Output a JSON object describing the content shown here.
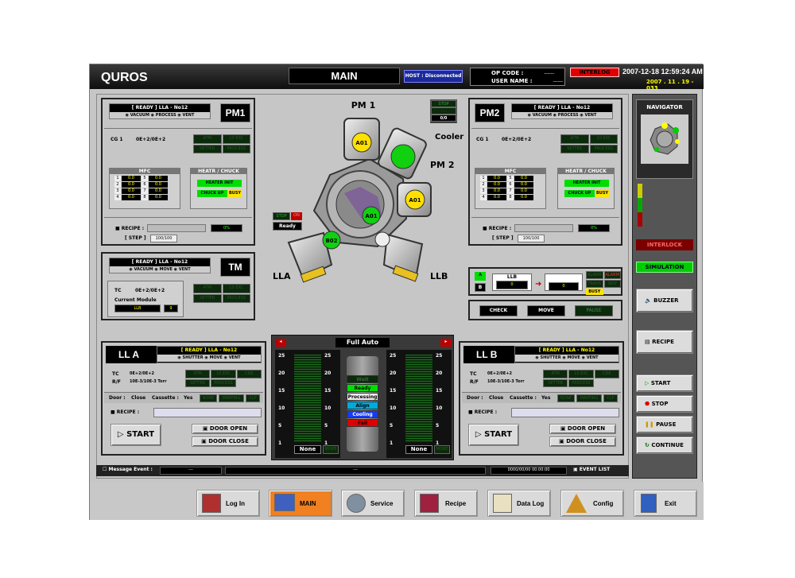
{
  "header": {
    "logo": "QUROS",
    "main": "MAIN",
    "host": "HOST : Disconnected",
    "op_code": "OP CODE :",
    "user_name": "USER NAME :",
    "op_val": "------",
    "user_val": "------",
    "interlog": "INTERLOG",
    "datetime": "2007-12-18 12:59:24 AM",
    "version": "2007 . 11 . 19 - 033"
  },
  "pm1": {
    "status": "[ READY ]  LLA - No12",
    "radios": [
      "VACUUM",
      "PROCESS",
      "VENT"
    ],
    "title": "PM1",
    "cg_label": "CG 1",
    "cg_val": "0E+2/0E+2",
    "state_cells": [
      "ATM",
      "10 EXC",
      "SETTER",
      "PROCESS"
    ],
    "mfc_title": "MFC",
    "mfc_rows": [
      [
        "1",
        "0.0",
        "5",
        "0.0"
      ],
      [
        "2",
        "0.0",
        "6",
        "0.0"
      ],
      [
        "3",
        "0.0",
        "7",
        "0.0"
      ],
      [
        "4",
        "0.0",
        "8",
        "0.0"
      ]
    ],
    "heat_title": "HEATR / CHUCK",
    "heater": "HEATER INIT",
    "chuck": "CHUCK UP",
    "busy": "BUSY",
    "recipe_label": "RECIPE :",
    "recipe_pct": "0%",
    "step_label": "[ STEP ]",
    "step_val": "100/100"
  },
  "pm2": {
    "status": "[ READY ]  LLA - No12",
    "radios": [
      "VACUUM",
      "PROCESS",
      "VENT"
    ],
    "title": "PM2",
    "cg_label": "CG 1",
    "cg_val": "0E+2/0E+2",
    "state_cells": [
      "ATM",
      "10 EXC",
      "SETTER",
      "PROCESS"
    ],
    "mfc_title": "MFC",
    "mfc_rows": [
      [
        "1",
        "0.0",
        "5",
        "0.0"
      ],
      [
        "2",
        "0.0",
        "6",
        "0.0"
      ],
      [
        "3",
        "0.0",
        "7",
        "0.0"
      ],
      [
        "4",
        "0.0",
        "8",
        "0.0"
      ]
    ],
    "heat_title": "HEATR / CHUCK",
    "heater": "HEATER INIT",
    "chuck": "CHUCK UP",
    "busy": "BUSY",
    "recipe_label": "RECIPE :",
    "recipe_pct": "0%",
    "step_label": "[ STEP ]",
    "step_val": "100/100"
  },
  "tm": {
    "status": "[ READY ]  LLA - No12",
    "radios": [
      "VACUUM",
      "MOVE",
      "VENT"
    ],
    "title": "TM",
    "tc_label": "TC",
    "tc_val": "0E+2/0E+2",
    "module_label": "Current Module",
    "module": "LLB",
    "module_num": "9",
    "state_cells": [
      "ATM",
      "10 EXC",
      "SETTER",
      "PROCESS"
    ]
  },
  "diagram": {
    "pm1": "PM 1",
    "pm2": "PM 2",
    "cooler": "Cooler",
    "lla": "LLA",
    "llb": "LLB",
    "wafers": [
      "A01",
      "A01",
      "A01",
      "B02"
    ],
    "cooler_box": [
      "STOP",
      "----",
      "0/0"
    ],
    "robot_status": "Ready",
    "robot_a": "STOP",
    "robot_b": "ON"
  },
  "transfer": {
    "a": "A",
    "b": "B",
    "llb": "LLB",
    "v1": "0",
    "v2": "0",
    "status_cells": [
      "ALARM",
      "ALARM",
      "TRANS",
      "SKIP",
      "BUSY"
    ],
    "check": "CHECK",
    "move": "MOVE",
    "pause": "PAUSE"
  },
  "lla": {
    "title": "LL A",
    "status": "[ READY ]  LLA - No12",
    "radios": [
      "SHUTTER",
      "MOVE",
      "VENT"
    ],
    "tc_label": "TC",
    "tc_val": "0E+2/0E+2",
    "rf_label": "R/F",
    "rf_val": "10E-3/10E-3 Torr",
    "cells": [
      "ATM",
      "10 EXC",
      "CDE",
      "SETTER",
      "PROCESS"
    ],
    "door_label": "Door :",
    "door": "Close",
    "cassette_label": "Cassette :",
    "cassette": "Yes",
    "extra": [
      "NONE",
      "MAPPING",
      "CLP"
    ],
    "recipe_label": "RECIPE :",
    "start": "START",
    "door_open": "DOOR OPEN",
    "door_close": "DOOR CLOSE"
  },
  "llb": {
    "title": "LL B",
    "status": "[ READY ]  LLA - No12",
    "radios": [
      "SHUTTER",
      "MOVE",
      "VENT"
    ],
    "tc_label": "TC",
    "tc_val": "0E+2/0E+2",
    "rf_label": "R/F",
    "rf_val": "10E-3/10E-3 Torr",
    "cells": [
      "ATM",
      "10 EXC",
      "CDE",
      "SETTER",
      "PROCESS"
    ],
    "door_label": "Door :",
    "door": "Close",
    "cassette_label": "Cassette :",
    "cassette": "Yes",
    "extra": [
      "NONE",
      "MAPPING",
      "CLP"
    ],
    "recipe_label": "RECIPE :",
    "start": "START",
    "door_open": "DOOR OPEN",
    "door_close": "DOOR CLOSE"
  },
  "auto": {
    "mode": "Full Auto",
    "scale": [
      "25",
      "20",
      "15",
      "10",
      "5",
      "1"
    ],
    "none": "None",
    "more": "MORE",
    "legend": [
      "Wait",
      "Ready",
      "Processing",
      "Align",
      "Cooling",
      "Fail"
    ]
  },
  "message": {
    "label": "Message Event :",
    "v1": "---",
    "v2": "---",
    "time": "0000/00/00 00:00:00",
    "event_list": "EVENT LIST"
  },
  "side": {
    "navigator": "NAVIGATOR",
    "interlock": "INTERLOCK",
    "simulation": "SIMULATION",
    "buzzer": "BUZZER",
    "recipe": "RECIPE",
    "start": "START",
    "stop": "STOP",
    "pause": "PAUSE",
    "continue": "CONTINUE"
  },
  "bottom": {
    "login": "Log In",
    "main": "MAIN",
    "service": "Service",
    "recipe": "Recipe",
    "datalog": "Data Log",
    "config": "Config",
    "exit": "Exit"
  }
}
